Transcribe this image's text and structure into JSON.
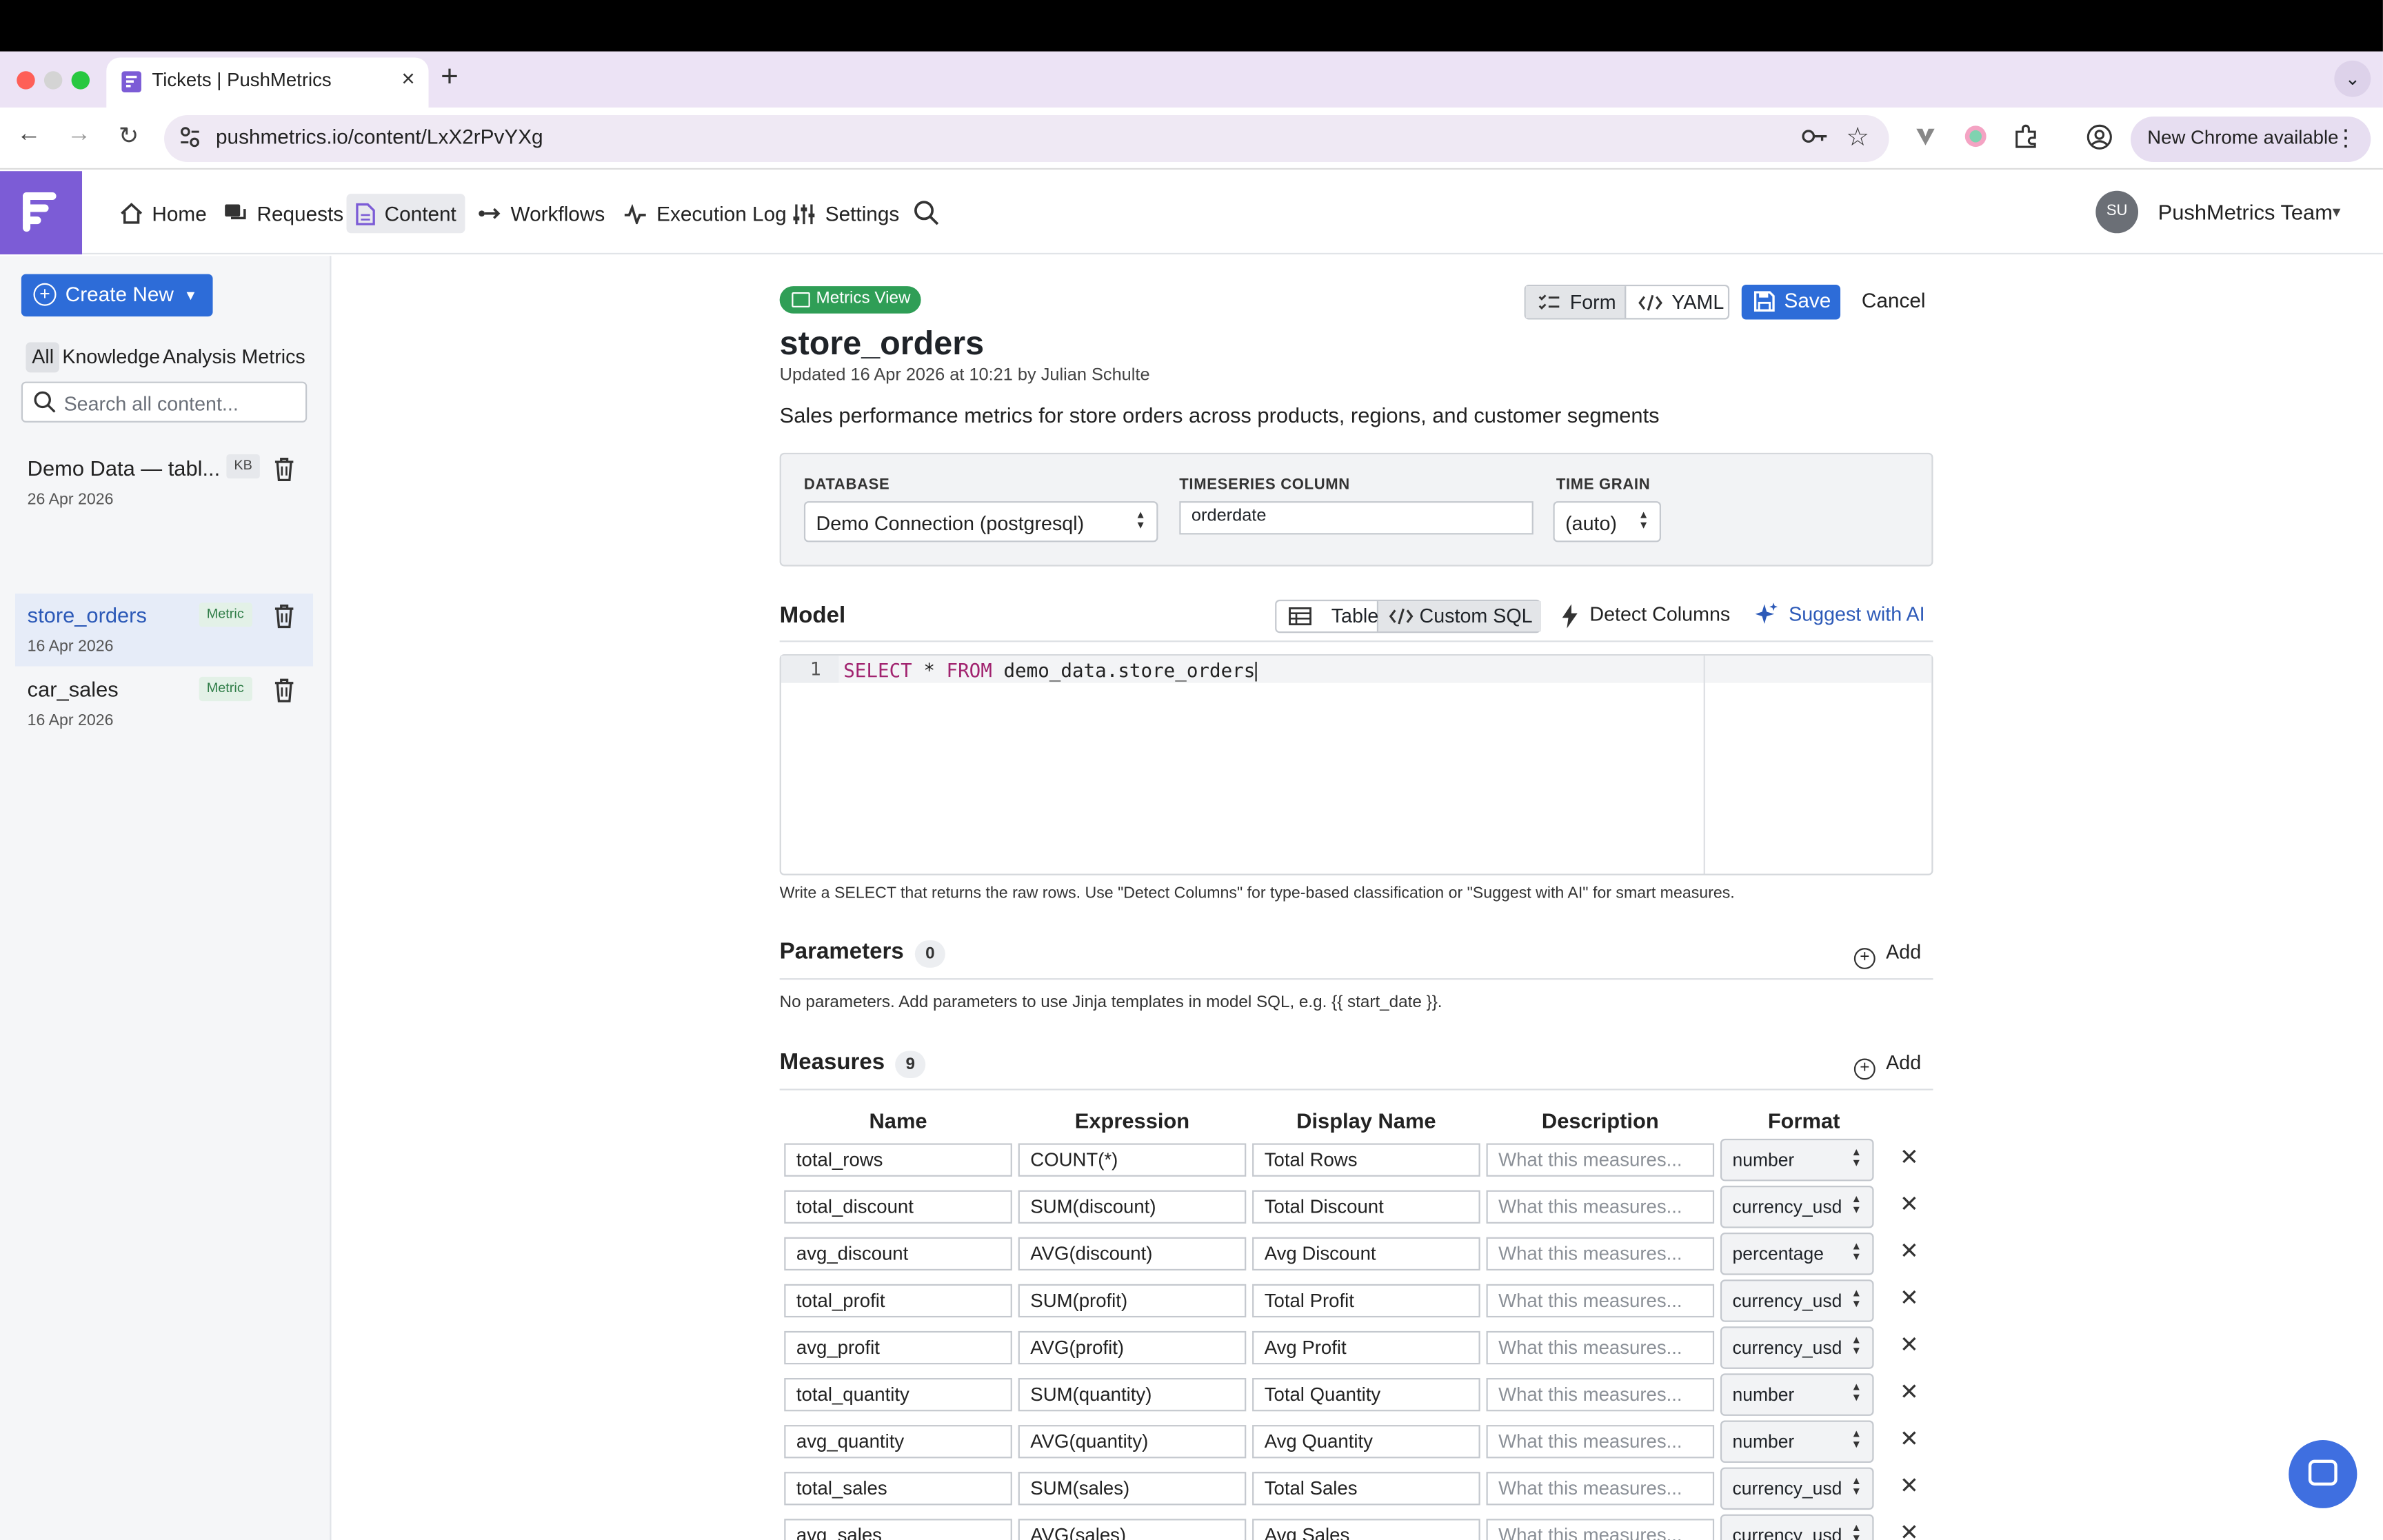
{
  "browser": {
    "tab_title": "Tickets | PushMetrics",
    "url": "pushmetrics.io/content/LxX2rPvYXg",
    "update_label": "New Chrome available"
  },
  "nav": {
    "items": [
      "Home",
      "Requests",
      "Content",
      "Workflows",
      "Execution Log",
      "Settings"
    ],
    "active": "Content",
    "avatar_initials": "SU",
    "team_name": "PushMetrics Team"
  },
  "sidebar": {
    "create_label": "Create New",
    "filters": [
      "All",
      "Knowledge",
      "Analysis",
      "Metrics"
    ],
    "active_filter": "All",
    "search_placeholder": "Search all content...",
    "items": [
      {
        "name": "Demo Data — tabl...",
        "badge": "KB",
        "date": "26 Apr 2026",
        "selected": false
      },
      {
        "name": "store_orders",
        "badge": "Metric",
        "date": "16 Apr 2026",
        "selected": true
      },
      {
        "name": "car_sales",
        "badge": "Metric",
        "date": "16 Apr 2026",
        "selected": false
      }
    ]
  },
  "header": {
    "type_badge": "Metrics View",
    "form_label": "Form",
    "yaml_label": "YAML",
    "save_label": "Save",
    "cancel_label": "Cancel",
    "title": "store_orders",
    "updated": "Updated 16 Apr 2026 at 10:21 by Julian Schulte",
    "description": "Sales performance metrics for store orders across products, regions, and customer segments"
  },
  "config": {
    "database_label": "DATABASE",
    "database_value": "Demo Connection (postgresql)",
    "timeseries_label": "TIMESERIES COLUMN",
    "timeseries_value": "orderdate",
    "grain_label": "TIME GRAIN",
    "grain_value": "(auto)"
  },
  "model": {
    "title": "Model",
    "table_label": "Table",
    "custom_sql_label": "Custom SQL",
    "detect_label": "Detect Columns",
    "suggest_label": "Suggest with AI",
    "line_number": "1",
    "sql_kw1": "SELECT",
    "sql_mid": " * ",
    "sql_kw2": "FROM",
    "sql_rest": " demo_data.store_orders",
    "hint": "Write a SELECT that returns the raw rows. Use \"Detect Columns\" for type-based classification or \"Suggest with AI\" for smart measures."
  },
  "parameters": {
    "title": "Parameters",
    "count": "0",
    "add_label": "Add",
    "empty_text": "No parameters. Add parameters to use Jinja templates in model SQL, e.g. {{ start_date }}."
  },
  "measures": {
    "title": "Measures",
    "count": "9",
    "add_label": "Add",
    "columns": [
      "Name",
      "Expression",
      "Display Name",
      "Description",
      "Format"
    ],
    "description_placeholder": "What this measures...",
    "rows": [
      {
        "name": "total_rows",
        "expression": "COUNT(*)",
        "display": "Total Rows",
        "format": "number"
      },
      {
        "name": "total_discount",
        "expression": "SUM(discount)",
        "display": "Total Discount",
        "format": "currency_usd"
      },
      {
        "name": "avg_discount",
        "expression": "AVG(discount)",
        "display": "Avg Discount",
        "format": "percentage"
      },
      {
        "name": "total_profit",
        "expression": "SUM(profit)",
        "display": "Total Profit",
        "format": "currency_usd"
      },
      {
        "name": "avg_profit",
        "expression": "AVG(profit)",
        "display": "Avg Profit",
        "format": "currency_usd"
      },
      {
        "name": "total_quantity",
        "expression": "SUM(quantity)",
        "display": "Total Quantity",
        "format": "number"
      },
      {
        "name": "avg_quantity",
        "expression": "AVG(quantity)",
        "display": "Avg Quantity",
        "format": "number"
      },
      {
        "name": "total_sales",
        "expression": "SUM(sales)",
        "display": "Total Sales",
        "format": "currency_usd"
      },
      {
        "name": "avg_sales",
        "expression": "AVG(sales)",
        "display": "Avg Sales",
        "format": "currency_usd"
      }
    ]
  },
  "colors": {
    "accent": "#2d6cd8",
    "brand": "#7c5cd6",
    "metrics_badge": "#2f9e56"
  }
}
